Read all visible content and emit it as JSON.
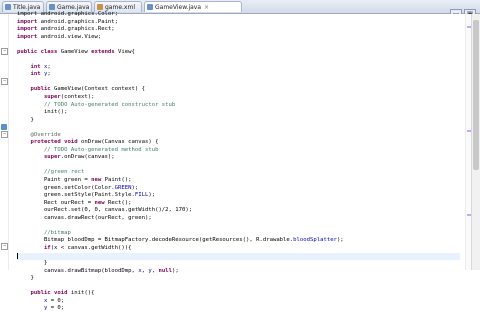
{
  "tabs": [
    {
      "label": "Title.java",
      "icon": "java-file-icon",
      "active": false
    },
    {
      "label": "Game.java",
      "icon": "java-file-icon",
      "active": false
    },
    {
      "label": "game.xml",
      "icon": "xml-file-icon",
      "active": false
    },
    {
      "label": "GameView.java",
      "icon": "java-file-icon",
      "active": true
    }
  ],
  "window_buttons": {
    "minimize": "▭",
    "maximize": "▣"
  },
  "colors": {
    "keyword": "#7f0055",
    "field": "#0000c0",
    "comment": "#3f7f5f",
    "annotation": "#646464"
  },
  "code_lines": [
    [
      [
        "import android.graphics.Color;",
        ""
      ]
    ],
    [
      [
        "import ",
        "kw"
      ],
      [
        "android.graphics.Paint;",
        ""
      ]
    ],
    [
      [
        "import ",
        "kw"
      ],
      [
        "android.graphics.Rect;",
        ""
      ]
    ],
    [
      [
        "import ",
        "kw"
      ],
      [
        "android.view.View;",
        ""
      ]
    ],
    [
      [
        "",
        ""
      ]
    ],
    [
      [
        "public class ",
        "kw"
      ],
      [
        "GameView ",
        ""
      ],
      [
        "extends ",
        "kw"
      ],
      [
        "View{",
        ""
      ]
    ],
    [
      [
        "",
        ""
      ]
    ],
    [
      [
        "    int ",
        "kw"
      ],
      [
        "x",
        "fld"
      ],
      [
        ";",
        ""
      ]
    ],
    [
      [
        "    int ",
        "kw"
      ],
      [
        "y",
        "fld"
      ],
      [
        ";",
        ""
      ]
    ],
    [
      [
        "",
        ""
      ]
    ],
    [
      [
        "    public ",
        "kw"
      ],
      [
        "GameView(Context context) {",
        ""
      ]
    ],
    [
      [
        "        super",
        "kw"
      ],
      [
        "(context);",
        ""
      ]
    ],
    [
      [
        "        // TODO Auto-generated constructor stub",
        "cm"
      ]
    ],
    [
      [
        "        init();",
        ""
      ]
    ],
    [
      [
        "    }",
        ""
      ]
    ],
    [
      [
        "",
        ""
      ]
    ],
    [
      [
        "    @Override",
        "an"
      ]
    ],
    [
      [
        "    protected void ",
        "kw"
      ],
      [
        "onDraw(Canvas canvas) {",
        ""
      ]
    ],
    [
      [
        "        // TODO Auto-generated method stub",
        "cm"
      ]
    ],
    [
      [
        "        super",
        "kw"
      ],
      [
        ".onDraw(canvas);",
        ""
      ]
    ],
    [
      [
        "",
        ""
      ]
    ],
    [
      [
        "        //green rect",
        "cm"
      ]
    ],
    [
      [
        "        Paint green = ",
        ""
      ],
      [
        "new ",
        "kw"
      ],
      [
        "Paint();",
        ""
      ]
    ],
    [
      [
        "        green.setColor(Color.",
        ""
      ],
      [
        "GREEN",
        "fld"
      ],
      [
        ");",
        ""
      ]
    ],
    [
      [
        "        green.setStyle(Paint.Style.",
        ""
      ],
      [
        "FILL",
        "fld"
      ],
      [
        ");",
        ""
      ]
    ],
    [
      [
        "        Rect ourRect = ",
        ""
      ],
      [
        "new ",
        "kw"
      ],
      [
        "Rect();",
        ""
      ]
    ],
    [
      [
        "        ourRect.set(0, 0, canvas.getWidth()/2, 170);",
        ""
      ]
    ],
    [
      [
        "        canvas.drawRect(ourRect, green);",
        ""
      ]
    ],
    [
      [
        "",
        ""
      ]
    ],
    [
      [
        "        //bitmap",
        "cm"
      ]
    ],
    [
      [
        "        Bitmap bloodDmp = BitmapFactory.decodeResource(getResources(), R.drawable.",
        ""
      ],
      [
        "bloodSplatter",
        "fld"
      ],
      [
        ");",
        ""
      ]
    ],
    [
      [
        "        if",
        "kw"
      ],
      [
        "(x < canvas.getWidth()){",
        ""
      ]
    ],
    [
      [
        "",
        ""
      ]
    ],
    [
      [
        "        }",
        ""
      ]
    ],
    [
      [
        "        canvas.drawBitmap(bloodDmp, ",
        ""
      ],
      [
        "x",
        "fld"
      ],
      [
        ", ",
        ""
      ],
      [
        "y",
        "fld"
      ],
      [
        ", ",
        ""
      ],
      [
        "null",
        "kw"
      ],
      [
        ");",
        ""
      ]
    ],
    [
      [
        "    }",
        ""
      ]
    ],
    [
      [
        "",
        ""
      ]
    ],
    [
      [
        "    public void ",
        "kw"
      ],
      [
        "init(){",
        ""
      ]
    ],
    [
      [
        "        ",
        ""
      ],
      [
        "x",
        "fld"
      ],
      [
        " = 0;",
        ""
      ]
    ],
    [
      [
        "        ",
        ""
      ],
      [
        "y",
        "fld"
      ],
      [
        " = 0;",
        ""
      ]
    ]
  ],
  "current_line": 32
}
